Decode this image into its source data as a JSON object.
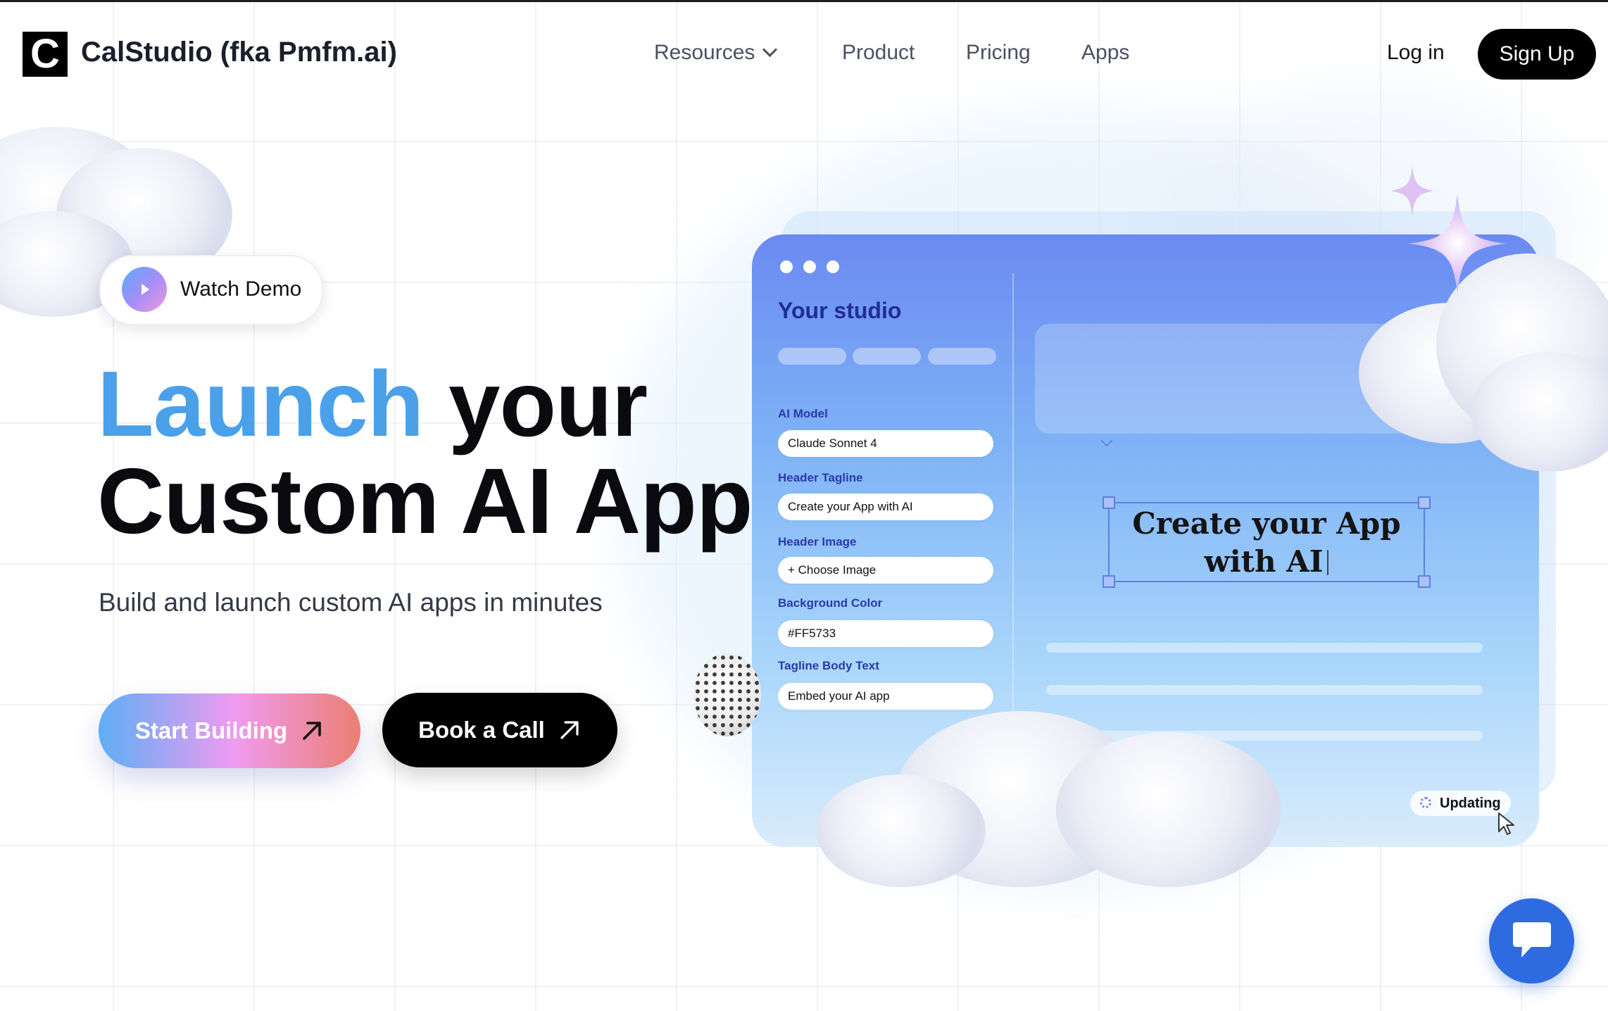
{
  "nav": {
    "logo_letter": "C",
    "brand": "CalStudio (fka Pmfm.ai)",
    "menu": {
      "resources": "Resources",
      "product": "Product",
      "pricing": "Pricing",
      "apps": "Apps"
    },
    "login": "Log in",
    "signup": "Sign Up"
  },
  "hero": {
    "watch_demo": "Watch Demo",
    "title_highlight": "Launch",
    "title_rest_line1": "your",
    "title_line2": "Custom AI App",
    "subtitle": "Build and launch custom AI apps in minutes",
    "start_building": "Start Building",
    "book_call": "Book a Call"
  },
  "studio": {
    "title": "Your studio",
    "fields": [
      {
        "label": "AI Model",
        "value": "Claude Sonnet 4"
      },
      {
        "label": "Header Tagline",
        "value": "Create your App with AI"
      },
      {
        "label": "Header Image",
        "value": "+ Choose Image"
      },
      {
        "label": "Background Color",
        "value": "#FF5733"
      },
      {
        "label": "Tagline Body Text",
        "value": "Embed your AI app"
      }
    ],
    "preview_line1": "Create your App",
    "preview_line2": "with AI",
    "status": "Updating"
  },
  "icons": {
    "play": "play-icon",
    "arrow": "arrow-up-right-icon",
    "chevron": "chevron-down-icon",
    "chat": "chat-icon",
    "cursor": "cursor-icon",
    "sparkle": "sparkle-icon"
  },
  "colors": {
    "accent_blue": "#4aa1ea",
    "card_top": "#6a8af2",
    "studio_title": "#1f2f8f",
    "chat_button": "#2f6be0",
    "black": "#000000"
  }
}
